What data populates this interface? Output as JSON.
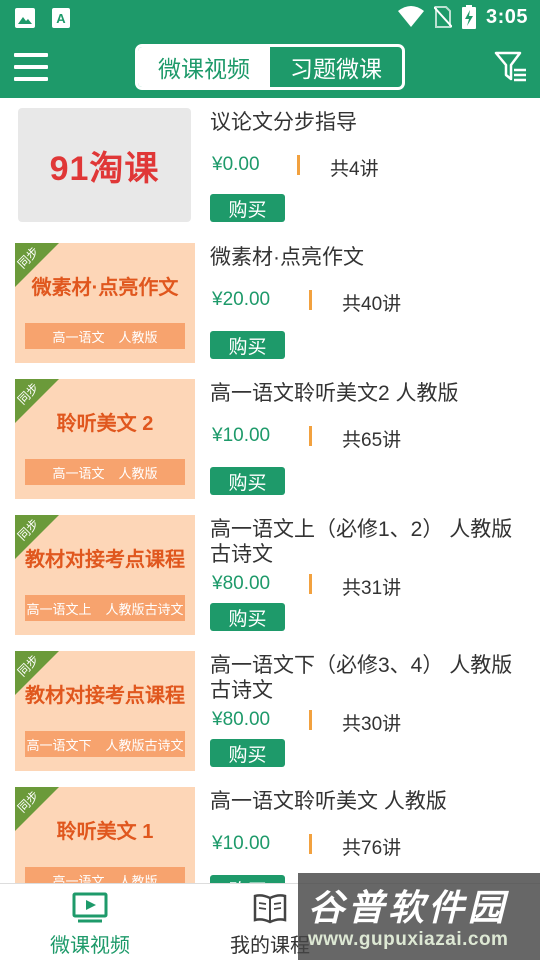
{
  "status_bar": {
    "time": "3:05",
    "icons": [
      "image-icon",
      "text-a-icon",
      "wifi-icon",
      "no-sim-icon",
      "battery-charging-icon"
    ]
  },
  "app_bar": {
    "menu_icon": "menu-icon",
    "tabs": [
      {
        "label": "微课视频",
        "active": true
      },
      {
        "label": "习题微课",
        "active": false
      }
    ],
    "filter_icon": "filter-icon"
  },
  "colors": {
    "brand_green": "#1e9a6a",
    "thumb_orange": "#fdd6b7",
    "thumb_title": "#e0571e",
    "divider_orange": "#f2a13f"
  },
  "courses": [
    {
      "title": "议论文分步指导",
      "price": "¥0.00",
      "lessons": "共4讲",
      "buy_label": "购买",
      "thumbnail": {
        "type": "logo",
        "logo_text": "91淘课"
      }
    },
    {
      "title": "微素材·点亮作文",
      "price": "¥20.00",
      "lessons": "共40讲",
      "buy_label": "购买",
      "thumbnail": {
        "type": "cover",
        "corner": "同步",
        "title": "微素材·点亮作文",
        "subject": "高一语文",
        "edition": "人教版"
      }
    },
    {
      "title": "高一语文聆听美文2 人教版",
      "price": "¥10.00",
      "lessons": "共65讲",
      "buy_label": "购买",
      "thumbnail": {
        "type": "cover",
        "corner": "同步",
        "title": "聆听美文 2",
        "subject": "高一语文",
        "edition": "人教版"
      }
    },
    {
      "title": "高一语文上（必修1、2） 人教版古诗文",
      "price": "¥80.00",
      "lessons": "共31讲",
      "buy_label": "购买",
      "thumbnail": {
        "type": "cover",
        "corner": "同步",
        "title": "教材对接考点课程",
        "subject": "高一语文上",
        "edition": "人教版古诗文"
      }
    },
    {
      "title": "高一语文下（必修3、4） 人教版古诗文",
      "price": "¥80.00",
      "lessons": "共30讲",
      "buy_label": "购买",
      "thumbnail": {
        "type": "cover",
        "corner": "同步",
        "title": "教材对接考点课程",
        "subject": "高一语文下",
        "edition": "人教版古诗文"
      }
    },
    {
      "title": "高一语文聆听美文 人教版",
      "price": "¥10.00",
      "lessons": "共76讲",
      "buy_label": "购买",
      "thumbnail": {
        "type": "cover",
        "corner": "同步",
        "title": "聆听美文 1",
        "subject": "高一语文",
        "edition": "人教版"
      }
    }
  ],
  "bottom_nav": [
    {
      "label": "微课视频",
      "icon": "video-play-icon",
      "active": true
    },
    {
      "label": "我的课程",
      "icon": "book-icon",
      "active": false
    }
  ],
  "watermark": {
    "text": "谷普软件园",
    "url": "www.gupuxiazai.com"
  }
}
